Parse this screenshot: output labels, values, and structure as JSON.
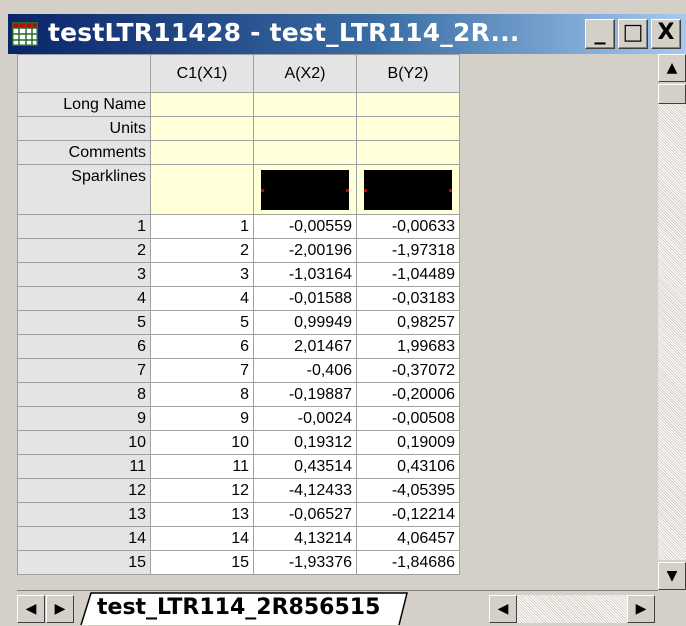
{
  "window": {
    "title": "testLTR11428 - test_LTR114_2R...",
    "minimize": "_",
    "maximize": "□",
    "close": "X"
  },
  "icons": {
    "app": "spreadsheet-icon",
    "scroll_up": "▲",
    "scroll_down": "▼",
    "first": "◀",
    "prev": "▶",
    "h_left": "◀",
    "h_right": "▶"
  },
  "columns": [
    "C1(X1)",
    "A(X2)",
    "B(Y2)"
  ],
  "meta_rows": [
    "Long Name",
    "Units",
    "Comments",
    "Sparklines"
  ],
  "rows": [
    {
      "label": "1",
      "c1": "1",
      "a": "-0,00559",
      "b": "-0,00633"
    },
    {
      "label": "2",
      "c1": "2",
      "a": "-2,00196",
      "b": "-1,97318"
    },
    {
      "label": "3",
      "c1": "3",
      "a": "-1,03164",
      "b": "-1,04489"
    },
    {
      "label": "4",
      "c1": "4",
      "a": "-0,01588",
      "b": "-0,03183"
    },
    {
      "label": "5",
      "c1": "5",
      "a": "0,99949",
      "b": "0,98257"
    },
    {
      "label": "6",
      "c1": "6",
      "a": "2,01467",
      "b": "1,99683"
    },
    {
      "label": "7",
      "c1": "7",
      "a": "-0,406",
      "b": "-0,37072"
    },
    {
      "label": "8",
      "c1": "8",
      "a": "-0,19887",
      "b": "-0,20006"
    },
    {
      "label": "9",
      "c1": "9",
      "a": "-0,0024",
      "b": "-0,00508"
    },
    {
      "label": "10",
      "c1": "10",
      "a": "0,19312",
      "b": "0,19009"
    },
    {
      "label": "11",
      "c1": "11",
      "a": "0,43514",
      "b": "0,43106"
    },
    {
      "label": "12",
      "c1": "12",
      "a": "-4,12433",
      "b": "-4,05395"
    },
    {
      "label": "13",
      "c1": "13",
      "a": "-0,06527",
      "b": "-0,12214"
    },
    {
      "label": "14",
      "c1": "14",
      "a": "4,13214",
      "b": "4,06457"
    },
    {
      "label": "15",
      "c1": "15",
      "a": "-1,93376",
      "b": "-1,84686"
    }
  ],
  "sheet_tab": "test_LTR114_2R856515",
  "colors": {
    "title_bar": "#0a246a",
    "meta_bg": "#ffffd8",
    "sparkline_bg": "#000000",
    "sparkline_dot": "#cc0000"
  }
}
